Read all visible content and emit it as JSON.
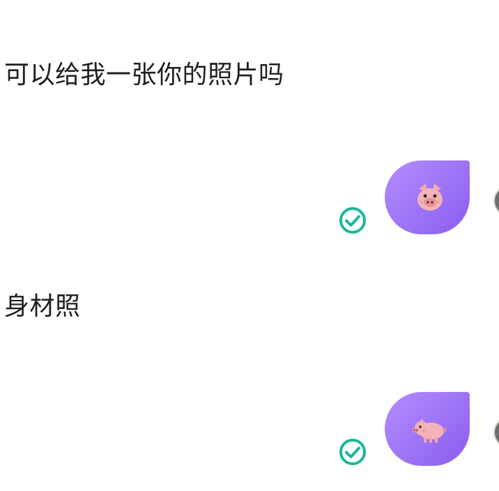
{
  "messages": [
    {
      "type": "received_text",
      "text": "可以给我一张你的照片吗"
    },
    {
      "type": "sent_sticker",
      "sticker": "pig-face-icon",
      "status": "read",
      "status_icon": "check-circle-icon"
    },
    {
      "type": "received_text",
      "text": "身材照"
    },
    {
      "type": "sent_sticker",
      "sticker": "pig-body-icon",
      "status": "read",
      "status_icon": "check-circle-icon"
    }
  ],
  "colors": {
    "bubble_gradient_start": "#b58cff",
    "bubble_gradient_end": "#8a5cf0",
    "check_green": "#18b89a",
    "pig_pink": "#f4b3b8",
    "text": "#1f1f1f",
    "background": "#ffffff"
  }
}
